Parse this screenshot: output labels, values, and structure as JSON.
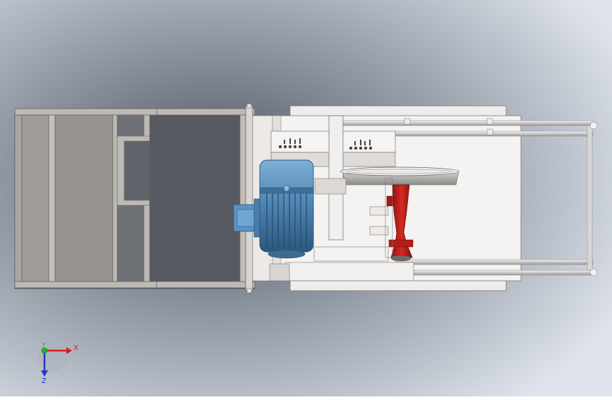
{
  "view": {
    "background": {
      "light": "#dde2ea",
      "mid": "#b9c0cb",
      "dark": "#6d7581"
    },
    "colors": {
      "frame": "#b4b0ab",
      "frame_dark": "#8a8782",
      "panel": "#f3f0ee",
      "motor": "#4f87b4",
      "motor_dark": "#2b5478",
      "shaft_red": "#c9201e",
      "shaft_red_dark": "#7e1010",
      "rod": "#cfcdcc",
      "outline": "#555555"
    },
    "model_parts": [
      "frame",
      "motor",
      "motor-junction-box",
      "control-panel-left",
      "control-panel-right",
      "rotating-plate",
      "universal-shaft",
      "guide-rods"
    ]
  },
  "triad": {
    "x_label": "X",
    "y_label": "Y",
    "z_label": "Z",
    "x_color": "#d21f1f",
    "y_color": "#22b03a",
    "z_color": "#2435c8"
  }
}
